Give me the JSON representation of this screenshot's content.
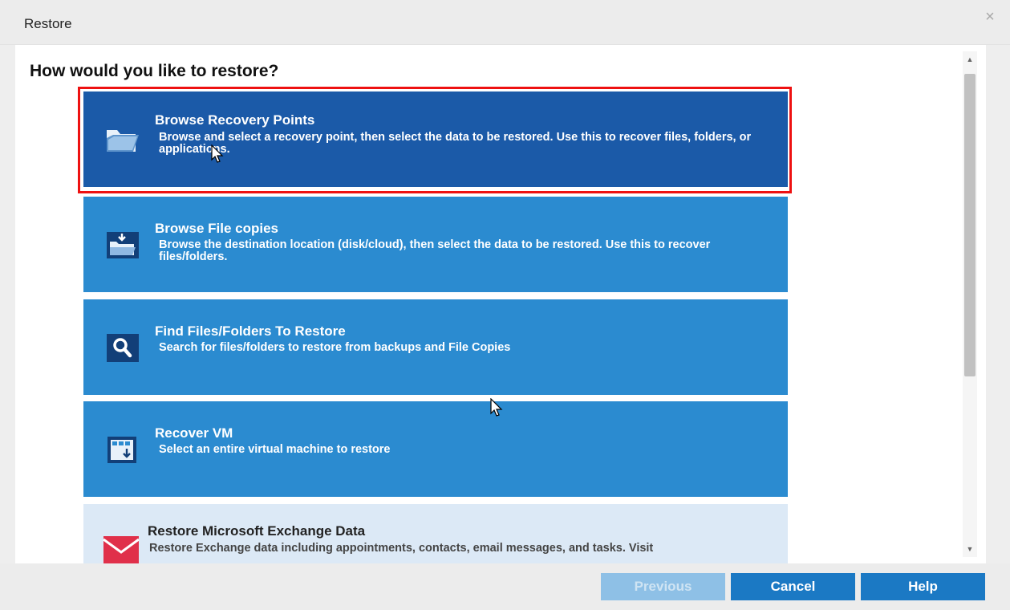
{
  "window": {
    "title": "Restore",
    "close_glyph": "×"
  },
  "heading": "How would you like to restore?",
  "options": [
    {
      "title": "Browse Recovery Points",
      "description": "Browse and select a recovery point, then select the data to be restored. Use this to recover files, folders, or applications.",
      "icon": "open-folder-icon",
      "state": "selected"
    },
    {
      "title": "Browse File copies",
      "description": "Browse the destination location (disk/cloud), then select the data to be restored. Use this to recover files/folders.",
      "icon": "folder-copy-icon",
      "state": "normal"
    },
    {
      "title": "Find Files/Folders To Restore",
      "description": "Search for files/folders to restore from backups and File Copies",
      "icon": "search-icon",
      "state": "normal"
    },
    {
      "title": "Recover VM",
      "description": "Select an entire virtual machine to restore",
      "icon": "virtual-machine-icon",
      "state": "normal"
    },
    {
      "title": "Restore Microsoft Exchange Data",
      "description": "Restore Exchange data including appointments, contacts, email messages, and tasks. Visit",
      "icon": "mail-icon",
      "state": "partially-visible"
    }
  ],
  "buttons": {
    "previous": "Previous",
    "cancel": "Cancel",
    "help": "Help"
  },
  "colors": {
    "selected": "#1b5aa8",
    "option": "#2b8bd0",
    "highlight_frame": "#ee1111",
    "exchange_bg": "#dce9f6",
    "button": "#1b79c4"
  }
}
